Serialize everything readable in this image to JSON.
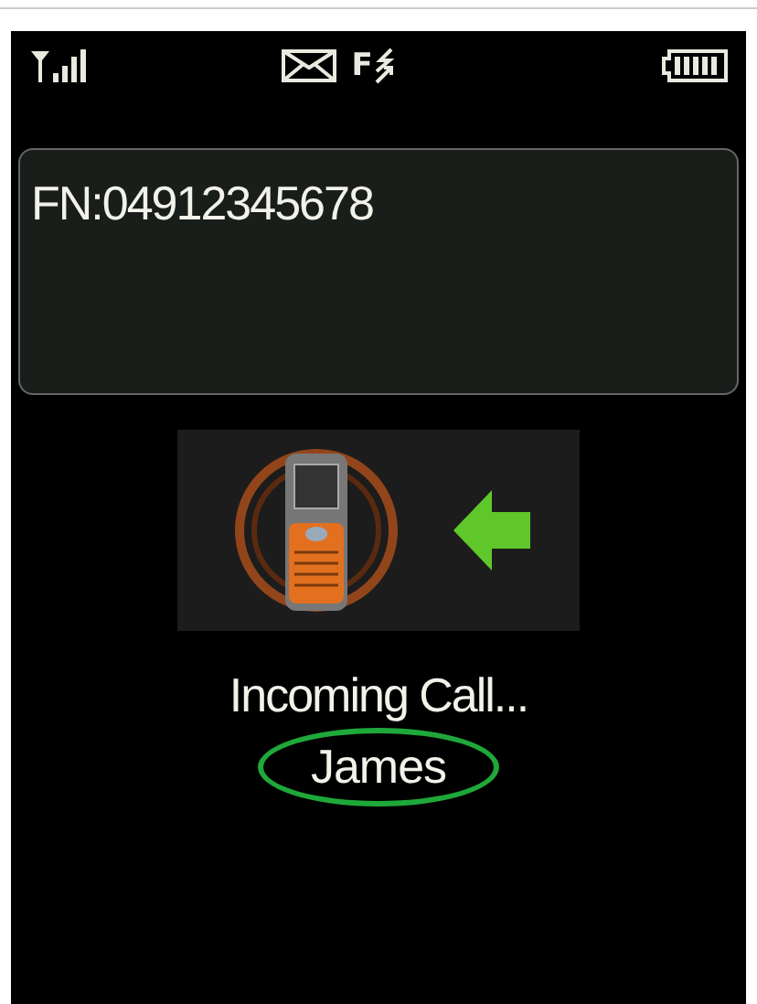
{
  "status_bar": {
    "forward_letter": "F"
  },
  "number_display": {
    "text": "FN:04912345678"
  },
  "call": {
    "status": "Incoming Call...",
    "caller": "James",
    "caller_highlighted": true
  }
}
